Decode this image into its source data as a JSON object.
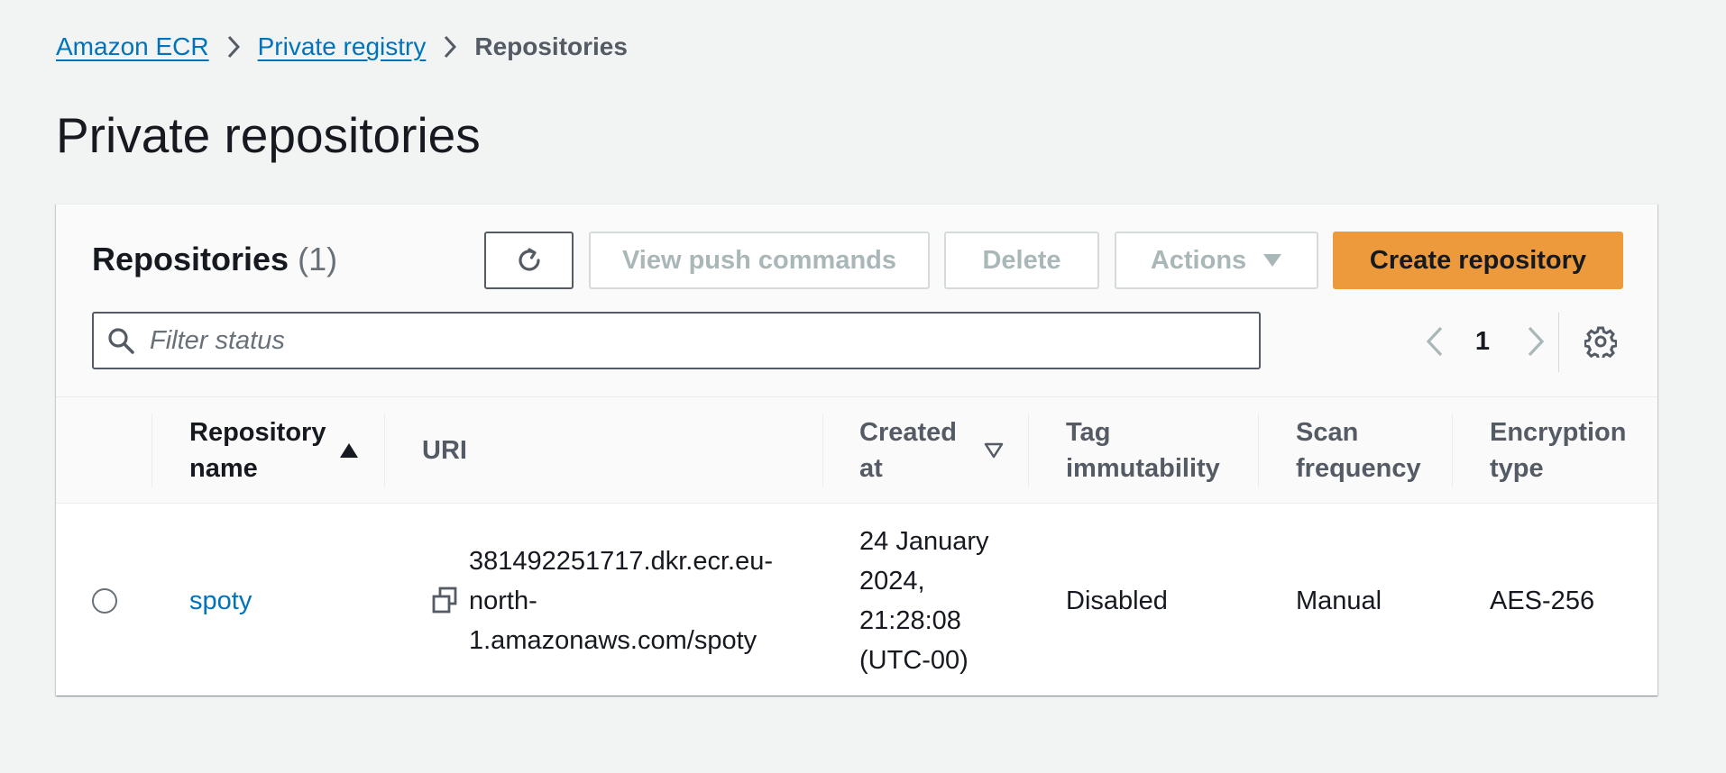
{
  "breadcrumb": {
    "items": [
      "Amazon ECR",
      "Private registry"
    ],
    "current": "Repositories"
  },
  "page_title": "Private repositories",
  "panel": {
    "title": "Repositories",
    "count": "(1)"
  },
  "toolbar": {
    "refresh_icon": "refresh-icon",
    "view_push_label": "View push commands",
    "delete_label": "Delete",
    "actions_label": "Actions",
    "create_label": "Create repository"
  },
  "filter": {
    "placeholder": "Filter status",
    "value": ""
  },
  "pagination": {
    "current_page": "1"
  },
  "table": {
    "columns": {
      "repo_name_line1": "Repository",
      "repo_name_line2": "name",
      "uri": "URI",
      "created_line1": "Created",
      "created_line2": "at",
      "tag_line1": "Tag",
      "tag_line2": "immutability",
      "scan_line1": "Scan",
      "scan_line2": "frequency",
      "enc_line1": "Encryption",
      "enc_line2": "type"
    },
    "rows": [
      {
        "name": "spoty",
        "uri_line1": "381492251717.dkr.ecr.eu-",
        "uri_line2": "north-",
        "uri_line3": "1.amazonaws.com/spoty",
        "created_line1": "24 January",
        "created_line2": "2024,",
        "created_line3": "21:28:08",
        "created_line4": "(UTC-00)",
        "tag_immutability": "Disabled",
        "scan_frequency": "Manual",
        "encryption_type": "AES-256"
      }
    ]
  },
  "colors": {
    "link": "#0073bb",
    "primary": "#ec9a3c",
    "background": "#f2f3f3"
  }
}
